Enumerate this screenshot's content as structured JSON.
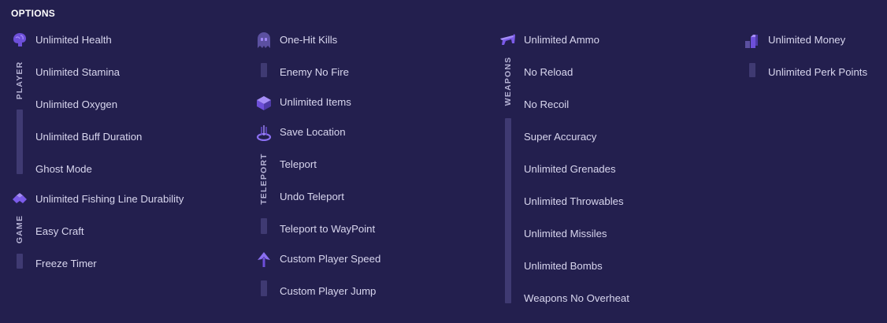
{
  "heading": "OPTIONS",
  "groups": {
    "player": {
      "label": "PLAYER",
      "icon": "brain-icon",
      "items": [
        "Unlimited Health",
        "Unlimited Stamina",
        "Unlimited Oxygen",
        "Unlimited Buff Duration",
        "Ghost Mode"
      ]
    },
    "game": {
      "label": "GAME",
      "icon": "puzzle-icon",
      "items": [
        "Unlimited Fishing Line Durability",
        "Easy Craft",
        "Freeze Timer"
      ]
    },
    "enemies": {
      "icon": "ghost-icon",
      "items": [
        "One-Hit Kills",
        "Enemy No Fire"
      ]
    },
    "inventory": {
      "icon": "box-icon",
      "items": [
        "Unlimited Items"
      ]
    },
    "teleport": {
      "label": "TELEPORT",
      "icon": "teleport-icon",
      "items": [
        "Save Location",
        "Teleport",
        "Undo Teleport",
        "Teleport to WayPoint"
      ]
    },
    "movement": {
      "icon": "arrow-up-icon",
      "items": [
        "Custom Player Speed",
        "Custom Player Jump"
      ]
    },
    "weapons": {
      "label": "WEAPONS",
      "icon": "gun-icon",
      "items": [
        "Unlimited Ammo",
        "No Reload",
        "No Recoil",
        "Super Accuracy",
        "Unlimited Grenades",
        "Unlimited Throwables",
        "Unlimited Missiles",
        "Unlimited Bombs",
        "Weapons No Overheat"
      ]
    },
    "economy": {
      "icon": "money-icon",
      "items": [
        "Unlimited Money",
        "Unlimited Perk Points"
      ]
    }
  },
  "colors": {
    "background": "#231f4e",
    "accent": "#7b5be8",
    "bar": "#3f3a72"
  }
}
